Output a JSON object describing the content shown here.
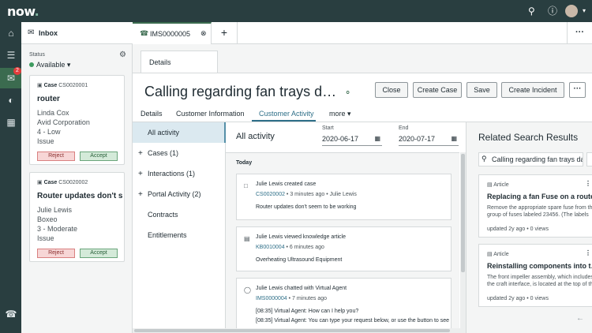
{
  "app": {
    "logo_text": "now",
    "logo_dot": "."
  },
  "topbar": {
    "search_icon": "search-icon",
    "help_icon": "help-icon"
  },
  "rail": {
    "badge_count": "2"
  },
  "inbox": {
    "title": "Inbox",
    "status_label": "Status",
    "status_value": "Available",
    "cards": [
      {
        "case_label": "Case",
        "case_number": "CS0020001",
        "title": "router",
        "contact": "Linda Cox",
        "company": "Avid Corporation",
        "priority": "4 - Low",
        "type": "Issue",
        "reject": "Reject",
        "accept": "Accept"
      },
      {
        "case_label": "Case",
        "case_number": "CS0020002",
        "title": "Router updates don't s...",
        "contact": "Julie Lewis",
        "company": "Boxeo",
        "priority": "3 - Moderate",
        "type": "Issue",
        "reject": "Reject",
        "accept": "Accept"
      }
    ]
  },
  "tabs": {
    "active_label": "IMS0000005",
    "add": "+",
    "more": "···"
  },
  "subtab": {
    "label": "Details"
  },
  "record": {
    "title": "Calling regarding fan trays d…",
    "buttons": {
      "close": "Close",
      "create_case": "Create Case",
      "save": "Save",
      "create_incident": "Create Incident",
      "more": "···"
    },
    "form_tabs": [
      "Details",
      "Customer Information",
      "Customer Activity",
      "more ▾"
    ]
  },
  "leftnav": {
    "items": [
      {
        "label": "All activity"
      },
      {
        "label": "Cases (1)",
        "plus": "+"
      },
      {
        "label": "Interactions (1)",
        "plus": "+"
      },
      {
        "label": "Portal Activity (2)",
        "plus": "+"
      },
      {
        "label": "Contracts"
      },
      {
        "label": "Entitlements"
      }
    ]
  },
  "activity": {
    "title": "All activity",
    "start_label": "Start",
    "start_value": "2020-06-17",
    "end_label": "End",
    "end_value": "2020-07-17",
    "today": "Today",
    "entries": [
      {
        "title": "Julie Lewis created case",
        "ref": "CS0020002",
        "meta": " • 3 minutes ago • Julie Lewis",
        "body": "Router updates don't seem to be working"
      },
      {
        "title": "Julie Lewis viewed knowledge article",
        "ref": "KB0010004",
        "meta": " • 6 minutes ago",
        "body": "Overheating Ultrasound Equipment"
      },
      {
        "title": "Julie Lewis chatted with Virtual Agent",
        "ref": "IMS0000004",
        "meta": " • 7 minutes ago",
        "body": "[08:35] Virtual Agent: How can I help you?",
        "body2": "[08:35] Virtual Agent: You can type your request below, or use the button to see"
      }
    ]
  },
  "related": {
    "title": "Related Search Results",
    "search_value": "Calling regarding fan trays da",
    "results": [
      {
        "type": "Article",
        "title": "Replacing a fan Fuse on a router",
        "lines": [
          "Remove the appropriate spare fuse from the",
          "group of fuses labeled 23456. (The labels"
        ],
        "meta": "updated 2y ago • 0 views"
      },
      {
        "type": "Article",
        "title": "Reinstalling components into t…",
        "lines": [
          "The front impeller assembly, which includes",
          "the craft interface, is located at the top of the"
        ],
        "meta": "updated 2y ago • 0 views"
      }
    ]
  },
  "colors": {
    "topbar": "#293e40",
    "accent": "#3b6b4f",
    "link": "#2e6f88",
    "reject": "#d98080",
    "accept": "#6aa57b"
  }
}
